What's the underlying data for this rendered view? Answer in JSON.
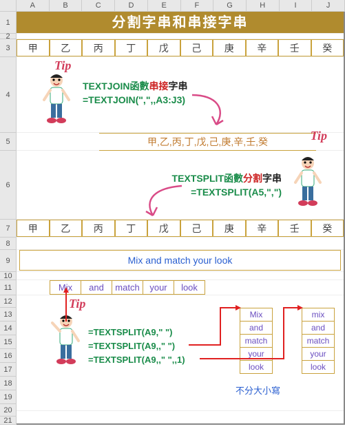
{
  "columns": [
    "A",
    "B",
    "C",
    "D",
    "E",
    "F",
    "G",
    "H",
    "I",
    "J"
  ],
  "rows": [
    "1",
    "2",
    "3",
    "4",
    "5",
    "6",
    "7",
    "8",
    "9",
    "10",
    "11",
    "12",
    "13",
    "14",
    "15",
    "16",
    "17",
    "18",
    "19",
    "20",
    "21"
  ],
  "title": "分割字串和串接字串",
  "stems": [
    "甲",
    "乙",
    "丙",
    "丁",
    "戊",
    "己",
    "庚",
    "辛",
    "壬",
    "癸"
  ],
  "tip_label": "Tip",
  "block1": {
    "fn_label_pre": "TEXTJOIN函數",
    "fn_label_action": "串接",
    "fn_label_post": "字串",
    "formula": "=TEXTJOIN(\",\",,A3:J3)",
    "result": "甲,乙,丙,丁,戊,己,庚,辛,壬,癸"
  },
  "block2": {
    "fn_label_pre": "TEXTSPLIT函數",
    "fn_label_action": "分割",
    "fn_label_post": "字串",
    "formula": "=TEXTSPLIT(A5,\",\")"
  },
  "sentence": "Mix and match your look",
  "words": [
    "Mix",
    "and",
    "match",
    "your",
    "look"
  ],
  "formulas": {
    "f1": "=TEXTSPLIT(A9,\" \")",
    "f2": "=TEXTSPLIT(A9,,\" \")",
    "f3": "=TEXTSPLIT(A9,,\" \",,1)"
  },
  "col_h": [
    "Mix",
    "and",
    "match",
    "your",
    "look"
  ],
  "col_j": [
    "mix",
    "and",
    "match",
    "your",
    "look"
  ],
  "note": "不分大小寫"
}
